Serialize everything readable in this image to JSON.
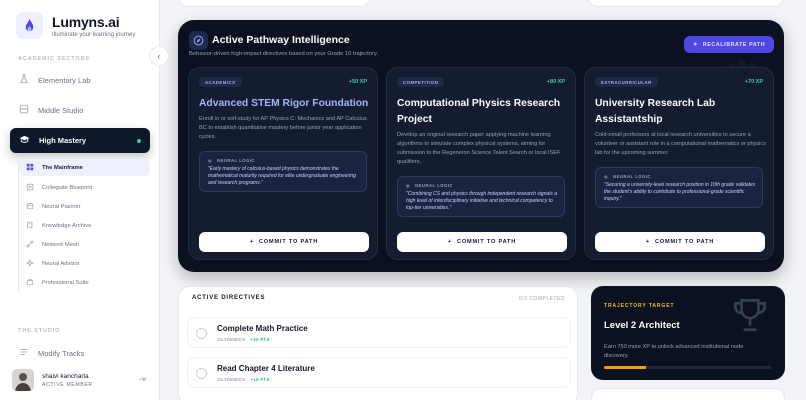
{
  "brand": {
    "name": "Lumyns.ai",
    "tagline": "Illuminate your learning journey"
  },
  "sidebar": {
    "section_academic": "ACADEMIC SECTORS",
    "items": [
      {
        "label": "Elementary Lab"
      },
      {
        "label": "Middle Studio"
      },
      {
        "label": "High Mastery"
      }
    ],
    "subitems": [
      {
        "label": "The Mainframe"
      },
      {
        "label": "Collegiate Blueprint"
      },
      {
        "label": "Neural Planner"
      },
      {
        "label": "Knowledge Archive"
      },
      {
        "label": "Network Mesh"
      },
      {
        "label": "Neural Advisor"
      },
      {
        "label": "Professional Suite"
      }
    ],
    "section_studio": "THE STUDIO",
    "studio_items": [
      {
        "label": "Modify Tracks"
      }
    ]
  },
  "user": {
    "name": "shaivi kancharla",
    "role": "ACTIVE MEMBER"
  },
  "hero": {
    "title": "Active Pathway Intelligence",
    "subtitle": "Behavior-driven high-impact directives based on your Grade 10 trajectory.",
    "button": "RECALIBRATE PATH",
    "cards": [
      {
        "tag": "ACADEMICS",
        "xp": "+50 XP",
        "title": "Advanced STEM Rigor Foundation",
        "desc": "Enroll in or self-study for AP Physics C: Mechanics and AP Calculus BC to establish quantitative mastery before junior year application cycles.",
        "logic_label": "NEURAL LOGIC",
        "logic": "\"Early mastery of calculus-based physics demonstrates the mathematical maturity required for elite undergraduate engineering and research programs.\"",
        "button": "COMMIT TO PATH"
      },
      {
        "tag": "COMPETITION",
        "xp": "+80 XP",
        "title": "Computational Physics Research Project",
        "desc": "Develop an original research paper applying machine learning algorithms to simulate complex physical systems, aiming for submission to the Regeneron Science Talent Search or local ISEF qualifiers.",
        "logic_label": "NEURAL LOGIC",
        "logic": "\"Combining CS and physics through independent research signals a high level of interdisciplinary initiative and technical competency to top-tier universities.\"",
        "button": "COMMIT TO PATH"
      },
      {
        "tag": "EXTRACURRICULAR",
        "xp": "+70 XP",
        "title": "University Research Lab Assistantship",
        "desc": "Cold-email professors at local research universities to secure a volunteer or assistant role in a computational mathematics or physics lab for the upcoming summer.",
        "logic_label": "NEURAL LOGIC",
        "logic": "\"Securing a university-level research position in 10th grade validates the student's ability to contribute to professional-grade scientific inquiry.\"",
        "button": "COMMIT TO PATH"
      }
    ]
  },
  "directives": {
    "title": "ACTIVE DIRECTIVES",
    "count": "0/3 COMPLETED",
    "items": [
      {
        "name": "Complete Math Practice",
        "category": "ACADEMICS",
        "xp": "+20 PTS"
      },
      {
        "name": "Read Chapter 4 Literature",
        "category": "ACADEMICS",
        "xp": "+15 PTS"
      }
    ]
  },
  "target": {
    "label": "TRAJECTORY TARGET",
    "title": "Level 2 Architect",
    "desc": "Earn 750 more XP to unlock advanced institutional node discovery.",
    "progress": 0.25
  },
  "colors": {
    "accent": "#4f46e5",
    "success": "#34d399",
    "gold": "#f59e0b",
    "dark": "#0b1120"
  }
}
